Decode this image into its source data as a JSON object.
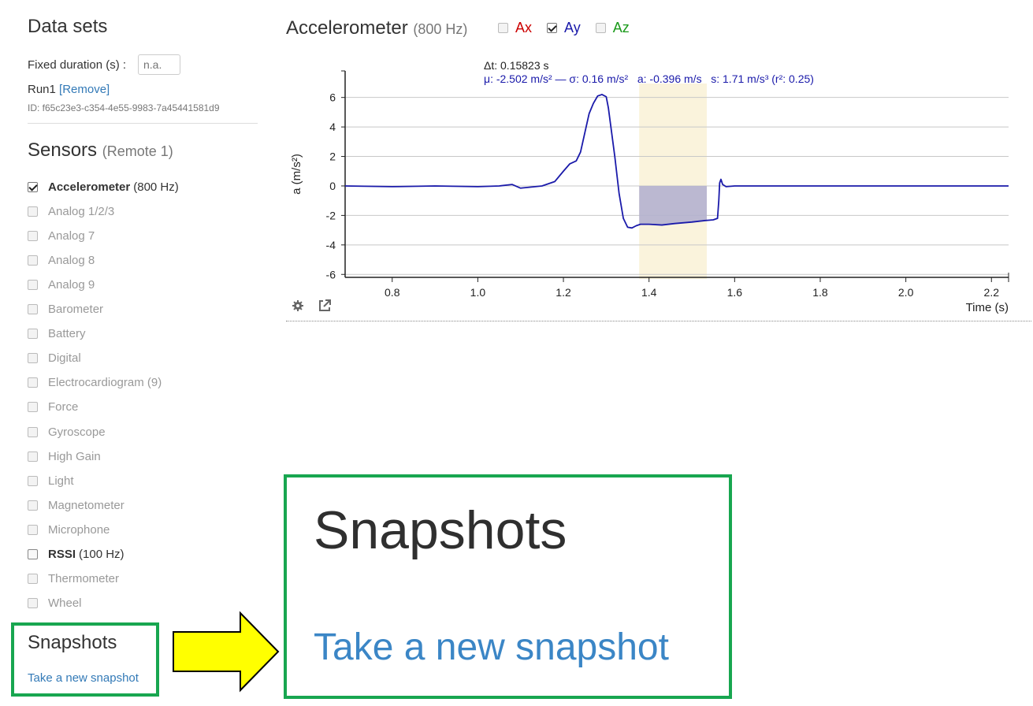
{
  "datasets": {
    "title": "Data sets",
    "fixed_duration_label": "Fixed duration (s) :",
    "fixed_duration_placeholder": "n.a.",
    "run_name": "Run1",
    "remove_label": "[Remove]",
    "run_id": "ID: f65c23e3-c354-4e55-9983-7a45441581d9"
  },
  "sensors": {
    "title": "Sensors",
    "subtitle": "(Remote 1)",
    "items": [
      {
        "label": "Accelerometer",
        "rate": "(800 Hz)",
        "checked": true,
        "enabled": true
      },
      {
        "label": "Analog 1/2/3",
        "rate": "",
        "checked": false,
        "enabled": false
      },
      {
        "label": "Analog 7",
        "rate": "",
        "checked": false,
        "enabled": false
      },
      {
        "label": "Analog 8",
        "rate": "",
        "checked": false,
        "enabled": false
      },
      {
        "label": "Analog 9",
        "rate": "",
        "checked": false,
        "enabled": false
      },
      {
        "label": "Barometer",
        "rate": "",
        "checked": false,
        "enabled": false
      },
      {
        "label": "Battery",
        "rate": "",
        "checked": false,
        "enabled": false
      },
      {
        "label": "Digital",
        "rate": "",
        "checked": false,
        "enabled": false
      },
      {
        "label": "Electrocardiogram (9)",
        "rate": "",
        "checked": false,
        "enabled": false
      },
      {
        "label": "Force",
        "rate": "",
        "checked": false,
        "enabled": false
      },
      {
        "label": "Gyroscope",
        "rate": "",
        "checked": false,
        "enabled": false
      },
      {
        "label": "High Gain",
        "rate": "",
        "checked": false,
        "enabled": false
      },
      {
        "label": "Light",
        "rate": "",
        "checked": false,
        "enabled": false
      },
      {
        "label": "Magnetometer",
        "rate": "",
        "checked": false,
        "enabled": false
      },
      {
        "label": "Microphone",
        "rate": "",
        "checked": false,
        "enabled": false
      },
      {
        "label": "RSSI",
        "rate": "(100 Hz)",
        "checked": false,
        "enabled": true
      },
      {
        "label": "Thermometer",
        "rate": "",
        "checked": false,
        "enabled": false
      },
      {
        "label": "Wheel",
        "rate": "",
        "checked": false,
        "enabled": false
      }
    ]
  },
  "snapshots": {
    "title": "Snapshots",
    "take_label": "Take a new snapshot"
  },
  "chart_header": {
    "title": "Accelerometer",
    "rate": "(800 Hz)",
    "axes": [
      {
        "label": "Ax",
        "checked": false,
        "color": "#cc0000"
      },
      {
        "label": "Ay",
        "checked": true,
        "color": "#1a1aaa"
      },
      {
        "label": "Az",
        "checked": false,
        "color": "#1a9a1a"
      }
    ]
  },
  "colors": {
    "series": "#1a1aaa",
    "selection_band": "#faf3dc",
    "selection_fill": "#b4b1cf",
    "highlight_box": "#18a650",
    "arrow_fill": "#ffff00",
    "link": "#337ab7"
  },
  "chart_data": {
    "type": "line",
    "xlabel": "Time (s)",
    "ylabel": "a (m/s²)",
    "xlim": [
      0.69,
      2.24
    ],
    "ylim": [
      -6.2,
      7.8
    ],
    "xticks": [
      0.8,
      1.0,
      1.2,
      1.4,
      1.6,
      1.8,
      2.0,
      2.2
    ],
    "yticks": [
      -6,
      -4,
      -2,
      0,
      2,
      4,
      6
    ],
    "grid": true,
    "selection": {
      "x_start": 1.377,
      "x_end": 1.535,
      "delta_label": "Δt: 0.15823 s",
      "stats_label": "μ: -2.502 m/s² — σ: 0.16 m/s²   a: -0.396 m/s   s: 1.71 m/s³ (r²: 0.25)"
    },
    "series": [
      {
        "name": "Ay",
        "x": [
          0.69,
          0.8,
          0.9,
          1.0,
          1.05,
          1.08,
          1.1,
          1.15,
          1.18,
          1.2,
          1.215,
          1.23,
          1.24,
          1.25,
          1.26,
          1.27,
          1.28,
          1.29,
          1.3,
          1.305,
          1.31,
          1.32,
          1.33,
          1.34,
          1.35,
          1.36,
          1.37,
          1.38,
          1.4,
          1.43,
          1.46,
          1.5,
          1.53,
          1.55,
          1.56,
          1.563,
          1.565,
          1.568,
          1.572,
          1.58,
          1.6,
          1.8,
          2.0,
          2.24
        ],
        "y": [
          0.0,
          -0.05,
          0.0,
          -0.05,
          0.0,
          0.1,
          -0.15,
          0.0,
          0.3,
          1.0,
          1.5,
          1.7,
          2.3,
          3.6,
          4.9,
          5.6,
          6.1,
          6.2,
          6.05,
          5.3,
          4.2,
          2.0,
          -0.5,
          -2.2,
          -2.8,
          -2.85,
          -2.7,
          -2.6,
          -2.6,
          -2.65,
          -2.55,
          -2.45,
          -2.35,
          -2.3,
          -2.2,
          -1.0,
          0.2,
          0.45,
          0.1,
          -0.05,
          0.0,
          0.0,
          0.0,
          0.0
        ]
      }
    ]
  }
}
